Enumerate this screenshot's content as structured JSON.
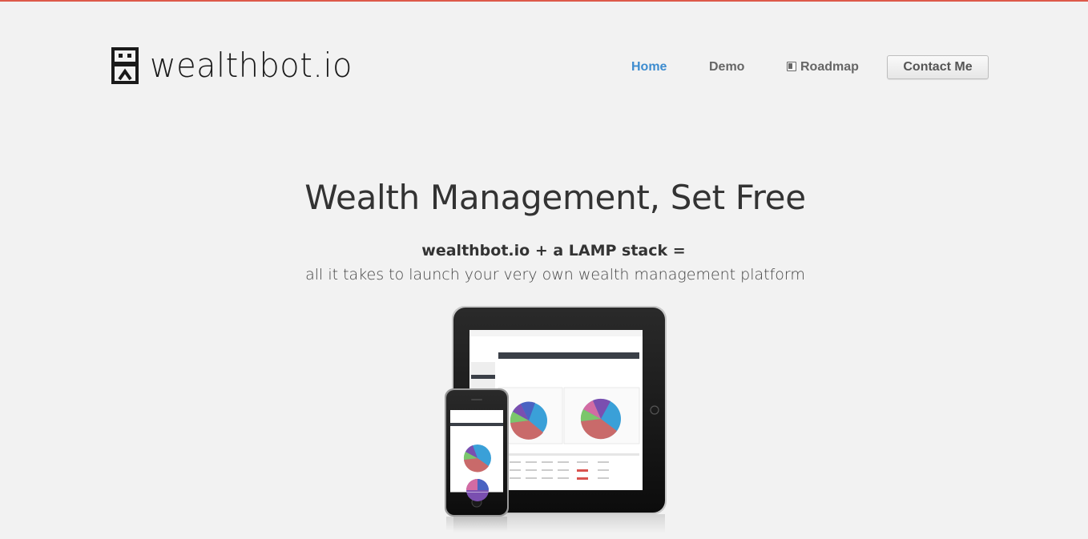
{
  "brand": {
    "name": "wealthbot.io",
    "accent_color": "#dd5a4a"
  },
  "nav": {
    "items": [
      {
        "label": "Home",
        "active": true
      },
      {
        "label": "Demo",
        "active": false
      },
      {
        "label": "Roadmap",
        "active": false,
        "icon": "trello-board-icon"
      }
    ],
    "contact_label": "Contact Me",
    "active_color": "#3d8ccf"
  },
  "hero": {
    "title": "Wealth Management, Set Free",
    "tagline_strong": "wealthbot.io + a LAMP stack =",
    "tagline": "all it takes to launch your very own wealth management platform"
  },
  "illustration": {
    "name": "tablet-and-phone-dashboard-illustration",
    "pie_colors": [
      "#3aa0d8",
      "#c96a6a",
      "#7bc66b",
      "#7a4fb0",
      "#4a63c2",
      "#d36ba3"
    ]
  }
}
